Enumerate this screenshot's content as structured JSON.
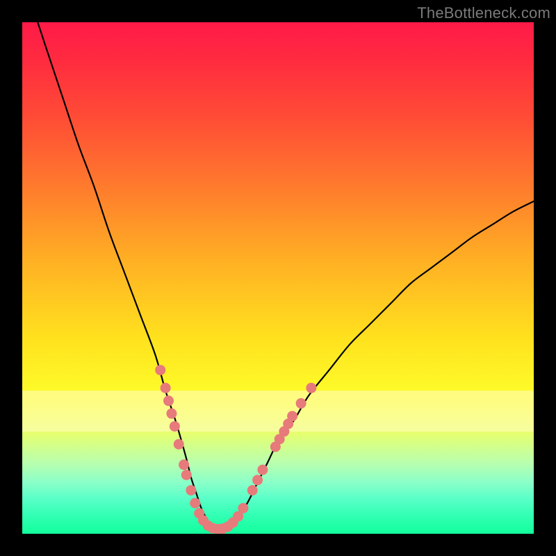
{
  "credit_text": "TheBottleneck.com",
  "colors": {
    "line": "#000000",
    "dot_fill": "#e77a7a",
    "dot_stroke": "#cf5f5f",
    "page_bg": "#000000"
  },
  "chart_data": {
    "type": "line",
    "title": "",
    "xlabel": "",
    "ylabel": "",
    "xlim": [
      0,
      100
    ],
    "ylim": [
      0,
      100
    ],
    "grid": false,
    "legend": null,
    "note": "No axis tick labels are rendered; x and y use a 0–100 normalized scale inferred from the plot frame.",
    "series": [
      {
        "name": "bottleneck-curve",
        "x": [
          0,
          2,
          5,
          8,
          11,
          14,
          17,
          20,
          23,
          26,
          28,
          30,
          32,
          33,
          34,
          35,
          36,
          37,
          38,
          39,
          40,
          42,
          44,
          46,
          48,
          50,
          53,
          56,
          60,
          64,
          68,
          72,
          76,
          80,
          84,
          88,
          92,
          96,
          100
        ],
        "y": [
          108,
          103,
          94,
          85,
          76,
          68,
          59,
          51,
          43,
          35,
          28,
          22,
          15,
          11,
          8,
          5,
          3,
          1.5,
          1,
          1,
          1.5,
          3,
          6,
          10,
          14,
          18,
          22,
          27,
          32,
          37,
          41,
          45,
          49,
          52,
          55,
          58,
          60.5,
          63,
          65
        ],
        "comment": "y measured as percent up from bottom; curve extends above top edge at x≈0."
      }
    ],
    "markers": {
      "name": "highlighted-dots",
      "color_ref": "dot_fill",
      "points": [
        {
          "x": 27.0,
          "y": 32.0
        },
        {
          "x": 28.0,
          "y": 28.5
        },
        {
          "x": 28.6,
          "y": 26.0
        },
        {
          "x": 29.2,
          "y": 23.5
        },
        {
          "x": 29.8,
          "y": 21.0
        },
        {
          "x": 30.6,
          "y": 17.5
        },
        {
          "x": 31.6,
          "y": 13.5
        },
        {
          "x": 32.1,
          "y": 11.5
        },
        {
          "x": 33.0,
          "y": 8.5
        },
        {
          "x": 33.8,
          "y": 6.0
        },
        {
          "x": 34.6,
          "y": 4.0
        },
        {
          "x": 35.4,
          "y": 2.6
        },
        {
          "x": 36.3,
          "y": 1.6
        },
        {
          "x": 37.2,
          "y": 1.1
        },
        {
          "x": 38.2,
          "y": 0.9
        },
        {
          "x": 39.2,
          "y": 1.0
        },
        {
          "x": 40.2,
          "y": 1.4
        },
        {
          "x": 41.2,
          "y": 2.2
        },
        {
          "x": 42.2,
          "y": 3.4
        },
        {
          "x": 43.2,
          "y": 5.0
        },
        {
          "x": 45.0,
          "y": 8.5
        },
        {
          "x": 46.0,
          "y": 10.5
        },
        {
          "x": 47.0,
          "y": 12.5
        },
        {
          "x": 49.5,
          "y": 17.0
        },
        {
          "x": 50.3,
          "y": 18.5
        },
        {
          "x": 51.2,
          "y": 20.0
        },
        {
          "x": 52.0,
          "y": 21.5
        },
        {
          "x": 52.8,
          "y": 23.0
        },
        {
          "x": 54.5,
          "y": 25.5
        },
        {
          "x": 56.5,
          "y": 28.5
        }
      ]
    },
    "bands": [
      {
        "name": "cream-band",
        "y_from": 20,
        "y_to": 28,
        "color": "#fffcc9",
        "opacity": 0.55
      }
    ]
  }
}
